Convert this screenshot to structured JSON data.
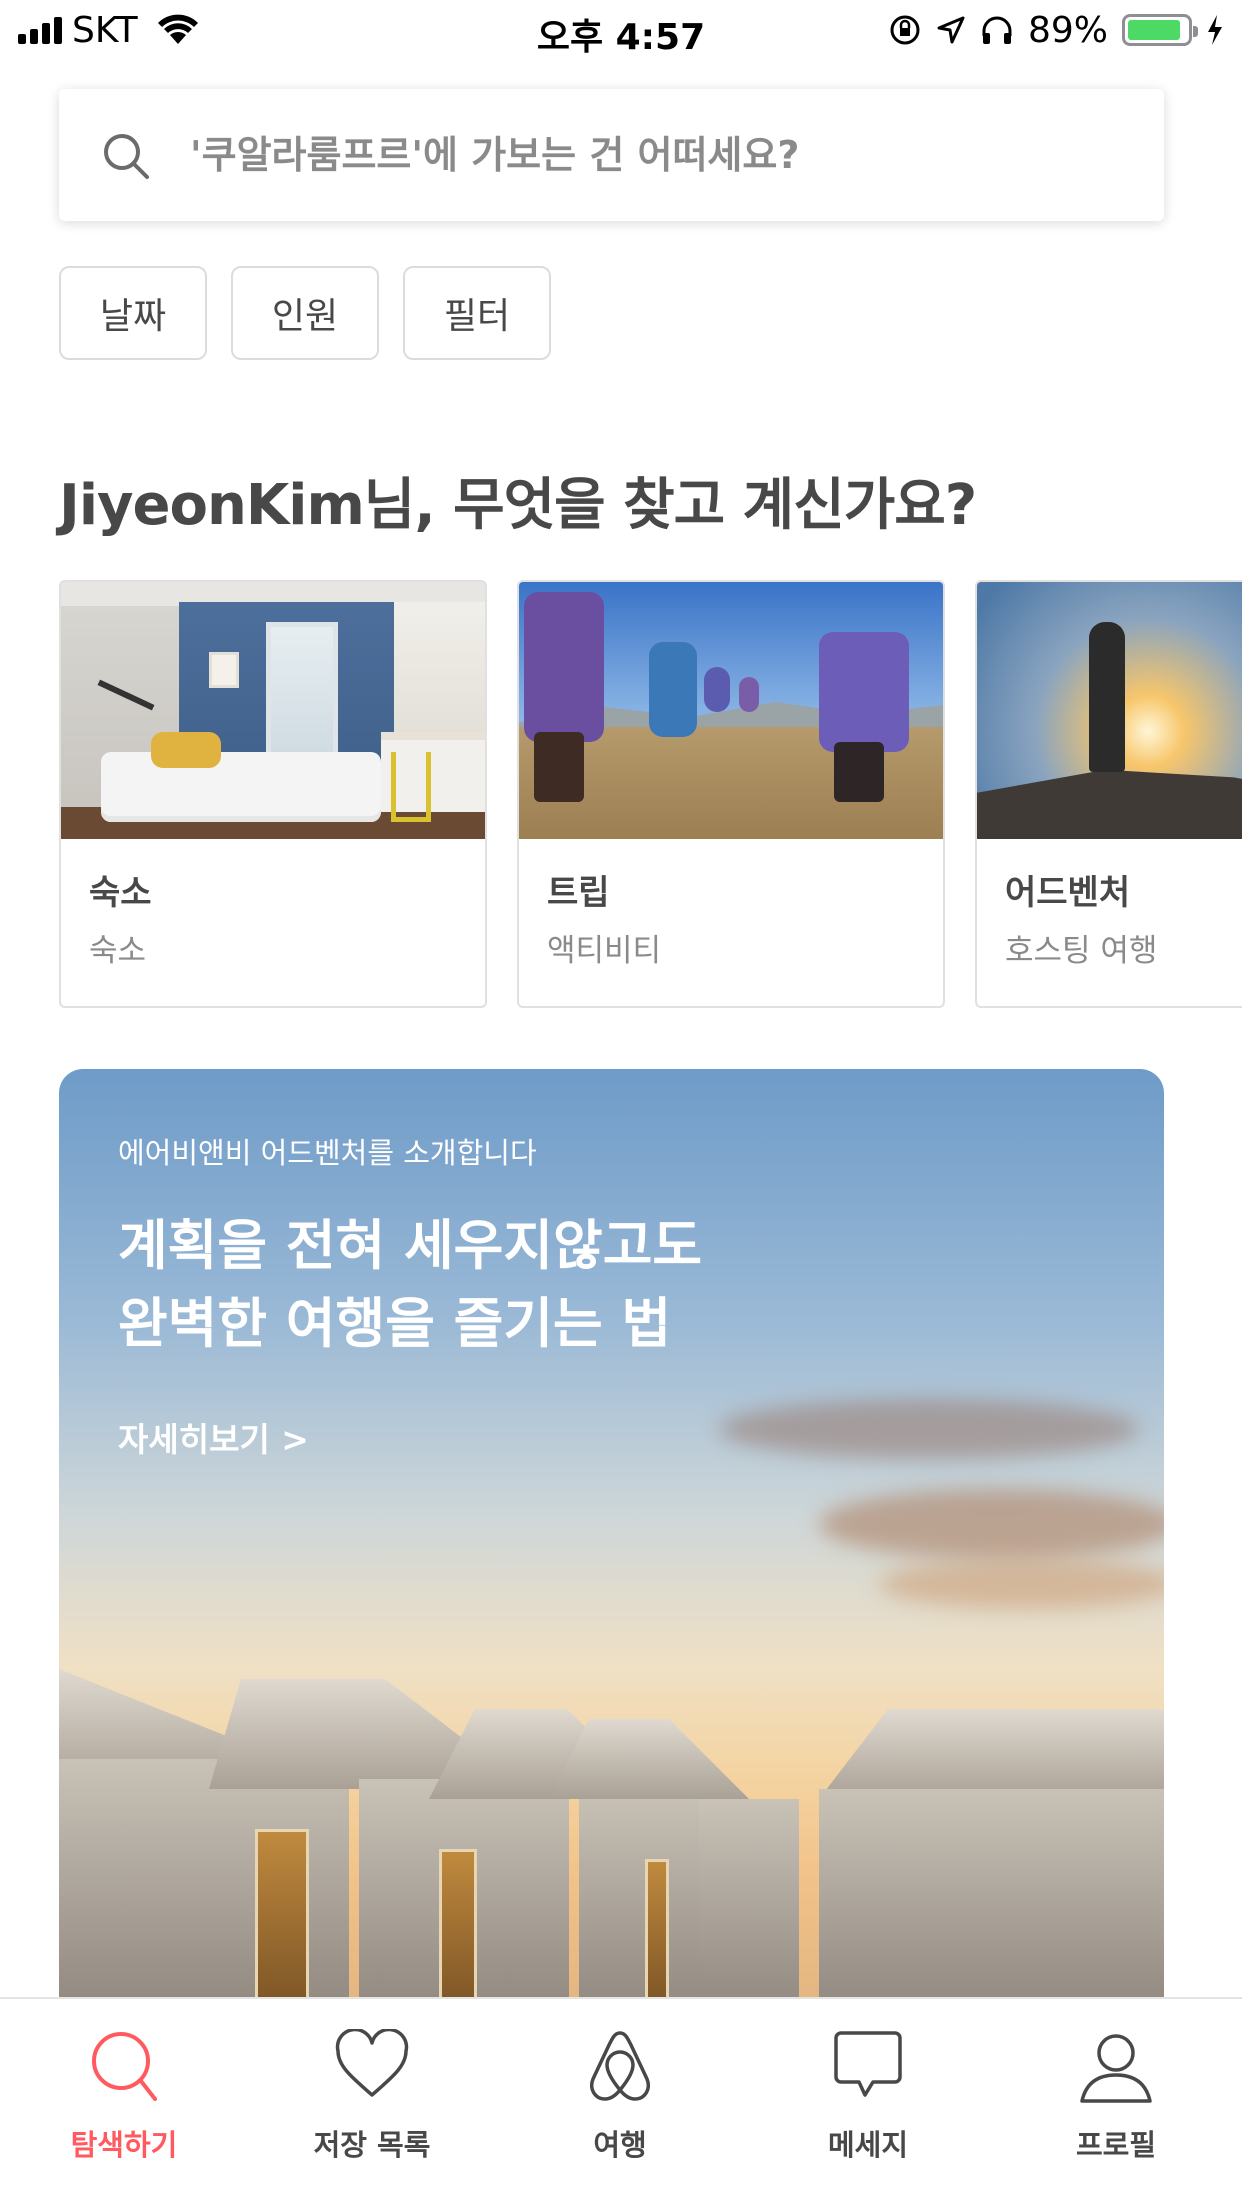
{
  "status_bar": {
    "carrier": "SKT",
    "time": "오후 4:57",
    "battery_percent": "89%",
    "battery_level": 0.89,
    "battery_color": "#4cd964"
  },
  "search": {
    "placeholder": "'쿠알라룸프르'에 가보는 건 어떠세요?"
  },
  "filters": [
    "날짜",
    "인원",
    "필터"
  ],
  "section_title": "JiyeonKim님, 무엇을 찾고 계신가요?",
  "categories": [
    {
      "title": "숙소",
      "subtitle": "숙소",
      "image": "bedroom"
    },
    {
      "title": "트립",
      "subtitle": "액티비티",
      "image": "hikers"
    },
    {
      "title": "어드벤처",
      "subtitle": "호스팅 여행",
      "image": "mountain-sunset"
    }
  ],
  "banner": {
    "kicker": "에어비앤비 어드벤처를 소개합니다",
    "title_line1": "계획을 전혀 세우지않고도",
    "title_line2": "완벽한 여행을 즐기는 법",
    "link": "자세히보기  >",
    "image": "desert-tents-sunset"
  },
  "tabs": [
    {
      "label": "탐색하기",
      "icon": "search-icon",
      "active": true
    },
    {
      "label": "저장 목록",
      "icon": "heart-icon",
      "active": false
    },
    {
      "label": "여행",
      "icon": "airbnb-logo-icon",
      "active": false
    },
    {
      "label": "메세지",
      "icon": "message-icon",
      "active": false
    },
    {
      "label": "프로필",
      "icon": "profile-icon",
      "active": false
    }
  ],
  "colors": {
    "accent": "#ff5a5f",
    "text": "#484848",
    "muted": "#8a8a8a"
  }
}
